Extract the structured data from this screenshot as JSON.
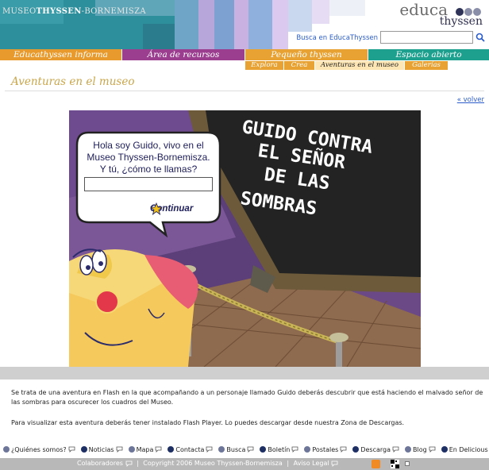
{
  "header": {
    "museum_logo_light": "MUSEO",
    "museum_logo_bold": "THYSSEN",
    "museum_logo_tail": "-BORNEMISZA",
    "educa_word": "educa",
    "thyssen_word": "thyssen",
    "search_label": "Busca en EducaThyssen",
    "search_value": ""
  },
  "nav": {
    "tabs": [
      {
        "label": "Educathyssen informa",
        "color": "#e89a2c"
      },
      {
        "label": "Área de recursos",
        "color": "#9b3e90"
      },
      {
        "label": "Pequeño thyssen",
        "color": "#e7a233"
      },
      {
        "label": "Espacio abierto",
        "color": "#1ea08f"
      }
    ],
    "subitems": [
      {
        "label": "Explora",
        "active": false
      },
      {
        "label": "Crea",
        "active": false
      },
      {
        "label": "Aventuras en el museo",
        "active": true
      },
      {
        "label": "Galerías",
        "active": false
      }
    ]
  },
  "page": {
    "title": "Aventuras en el museo",
    "back_link": "« volver"
  },
  "game": {
    "bubble_lines": [
      "Hola soy Guido, vivo en el",
      "Museo Thyssen-Bornemisza.",
      "Y tú, ¿cómo te llamas?"
    ],
    "name_value": "",
    "continue_label": "Continuar",
    "board_lines": [
      "GUIDO CONTRA",
      "EL SEÑOR",
      "DE LAS",
      "SOMBRAS"
    ]
  },
  "content": {
    "description": "Se trata de una aventura en Flash en la que acompañando a un personaje llamado Guido deberás descubrir que está haciendo el malvado señor de las sombras para oscurecer los cuadros del Museo.",
    "flash_note": "Para visualizar esta aventura deberás tener instalado Flash Player. Lo puedes descargar desde nuestra Zona de Descargas."
  },
  "footer": {
    "links": [
      {
        "label": "¿Quiénes somos?",
        "light": true
      },
      {
        "label": "Noticias",
        "light": false
      },
      {
        "label": "Mapa",
        "light": true
      },
      {
        "label": "Contacta",
        "light": false
      },
      {
        "label": "Busca",
        "light": true
      },
      {
        "label": "Boletín",
        "light": false
      },
      {
        "label": "Postales",
        "light": true
      },
      {
        "label": "Descarga",
        "light": false
      },
      {
        "label": "Blog",
        "light": true
      },
      {
        "label": "En Delicious",
        "light": false
      }
    ],
    "colaboradores": "Colaboradores",
    "copyright": "Copyright 2006 Museo Thyssen-Bornemisza",
    "aviso_legal": "Aviso Legal"
  },
  "colors": {
    "link_blue": "#2b5cc9",
    "title_gold": "#c9a64a",
    "subnav_orange": "#e7a233",
    "footer_gray": "#b8b8b8"
  }
}
